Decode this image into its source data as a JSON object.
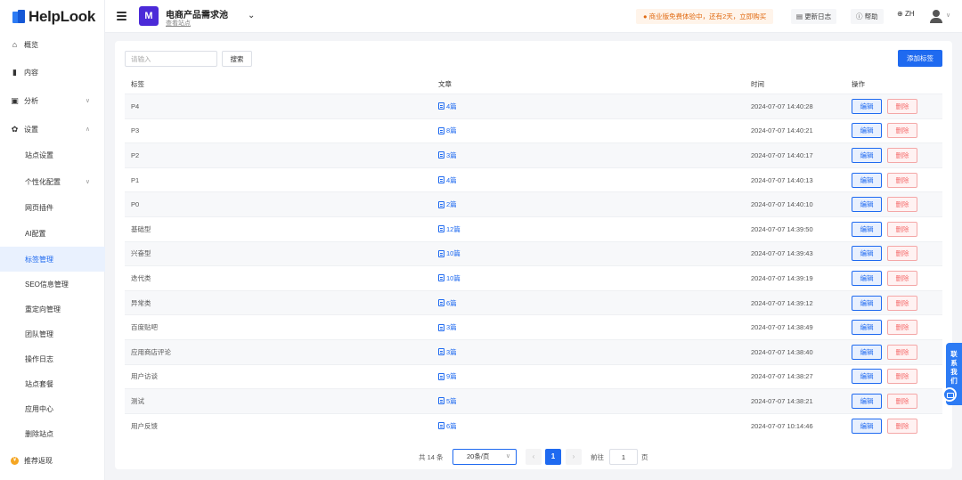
{
  "app": {
    "brand": "HelpLook"
  },
  "sidebar": {
    "items": [
      {
        "label": "概览",
        "icon": "home-icon"
      },
      {
        "label": "内容",
        "icon": "book-icon"
      },
      {
        "label": "分析",
        "icon": "chart-icon"
      },
      {
        "label": "设置",
        "icon": "gear-icon"
      }
    ],
    "settings_sub": [
      {
        "label": "站点设置"
      },
      {
        "label": "个性化配置"
      },
      {
        "label": "网页插件"
      },
      {
        "label": "AI配置"
      },
      {
        "label": "标签管理"
      },
      {
        "label": "SEO信息管理"
      },
      {
        "label": "重定向管理"
      },
      {
        "label": "团队管理"
      },
      {
        "label": "操作日志"
      },
      {
        "label": "站点套餐"
      },
      {
        "label": "应用中心"
      },
      {
        "label": "删除站点"
      }
    ],
    "referral": "推荐返现"
  },
  "header": {
    "site_logo_letter": "M",
    "site_name": "电商产品需求池",
    "view_site": "查看站点",
    "trial_notice": "商业版免费体验中，还有2天，立即购买",
    "changelog": "更新日志",
    "help": "帮助",
    "lang": "ZH"
  },
  "toolbar": {
    "search_placeholder": "请输入",
    "search_label": "搜索",
    "add_label": "添加标签"
  },
  "table": {
    "headers": [
      "标签",
      "文章",
      "时间",
      "操作"
    ],
    "edit_label": "编辑",
    "delete_label": "删除",
    "rows": [
      {
        "tag": "P4",
        "articles": "4篇",
        "time": "2024-07-07 14:40:28"
      },
      {
        "tag": "P3",
        "articles": "8篇",
        "time": "2024-07-07 14:40:21"
      },
      {
        "tag": "P2",
        "articles": "3篇",
        "time": "2024-07-07 14:40:17"
      },
      {
        "tag": "P1",
        "articles": "4篇",
        "time": "2024-07-07 14:40:13"
      },
      {
        "tag": "P0",
        "articles": "2篇",
        "time": "2024-07-07 14:40:10"
      },
      {
        "tag": "基础型",
        "articles": "12篇",
        "time": "2024-07-07 14:39:50"
      },
      {
        "tag": "兴奋型",
        "articles": "10篇",
        "time": "2024-07-07 14:39:43"
      },
      {
        "tag": "迭代类",
        "articles": "10篇",
        "time": "2024-07-07 14:39:19"
      },
      {
        "tag": "异常类",
        "articles": "6篇",
        "time": "2024-07-07 14:39:12"
      },
      {
        "tag": "百度贴吧",
        "articles": "3篇",
        "time": "2024-07-07 14:38:49"
      },
      {
        "tag": "应用商店评论",
        "articles": "3篇",
        "time": "2024-07-07 14:38:40"
      },
      {
        "tag": "用户访谈",
        "articles": "9篇",
        "time": "2024-07-07 14:38:27"
      },
      {
        "tag": "测试",
        "articles": "5篇",
        "time": "2024-07-07 14:38:21"
      },
      {
        "tag": "用户反馈",
        "articles": "6篇",
        "time": "2024-07-07 10:14:46"
      }
    ]
  },
  "pagination": {
    "total": "共 14 条",
    "page_size": "20条/页",
    "current": "1",
    "goto_prefix": "前往",
    "goto_value": "1",
    "goto_suffix": "页"
  },
  "float": {
    "contact": "联系我们"
  },
  "colors": {
    "primary": "#1f6af0",
    "danger": "#f56c6c",
    "warning": "#e06a12"
  }
}
